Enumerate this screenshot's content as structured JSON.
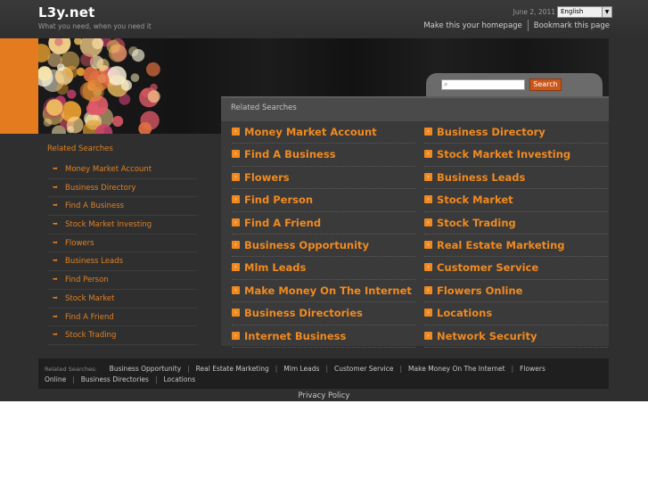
{
  "header": {
    "logo": "L3y.net",
    "tagline": "What you need, when you need it",
    "date": "June 2, 2011",
    "language": "English",
    "homepage_link": "Make this your homepage",
    "bookmark_link": "Bookmark this page"
  },
  "search": {
    "placeholder": "",
    "button": "Search"
  },
  "main": {
    "title": "Related Searches",
    "left": [
      "Money Market Account",
      "Find A Business",
      "Flowers",
      "Find Person",
      "Find A Friend",
      "Business Opportunity",
      "Mlm Leads",
      "Make Money On The Internet",
      "Business Directories",
      "Internet Business"
    ],
    "right": [
      "Business Directory",
      "Stock Market Investing",
      "Business Leads",
      "Stock Market",
      "Stock Trading",
      "Real Estate Marketing",
      "Customer Service",
      "Flowers Online",
      "Locations",
      "Network Security"
    ]
  },
  "sidebar": {
    "title": "Related Searches",
    "items": [
      "Money Market Account",
      "Business Directory",
      "Find A Business",
      "Stock Market Investing",
      "Flowers",
      "Business Leads",
      "Find Person",
      "Stock Market",
      "Find A Friend",
      "Stock Trading"
    ]
  },
  "footer": {
    "label": "Related Searches:",
    "links": [
      "Business Opportunity",
      "Real Estate Marketing",
      "Mlm Leads",
      "Customer Service",
      "Make Money On The Internet",
      "Flowers Online",
      "Business Directories",
      "Locations"
    ],
    "privacy": "Privacy Policy"
  },
  "colors": {
    "accent": "#f08a20",
    "background": "#2f2f2f",
    "orange_block": "#e47b1f"
  }
}
